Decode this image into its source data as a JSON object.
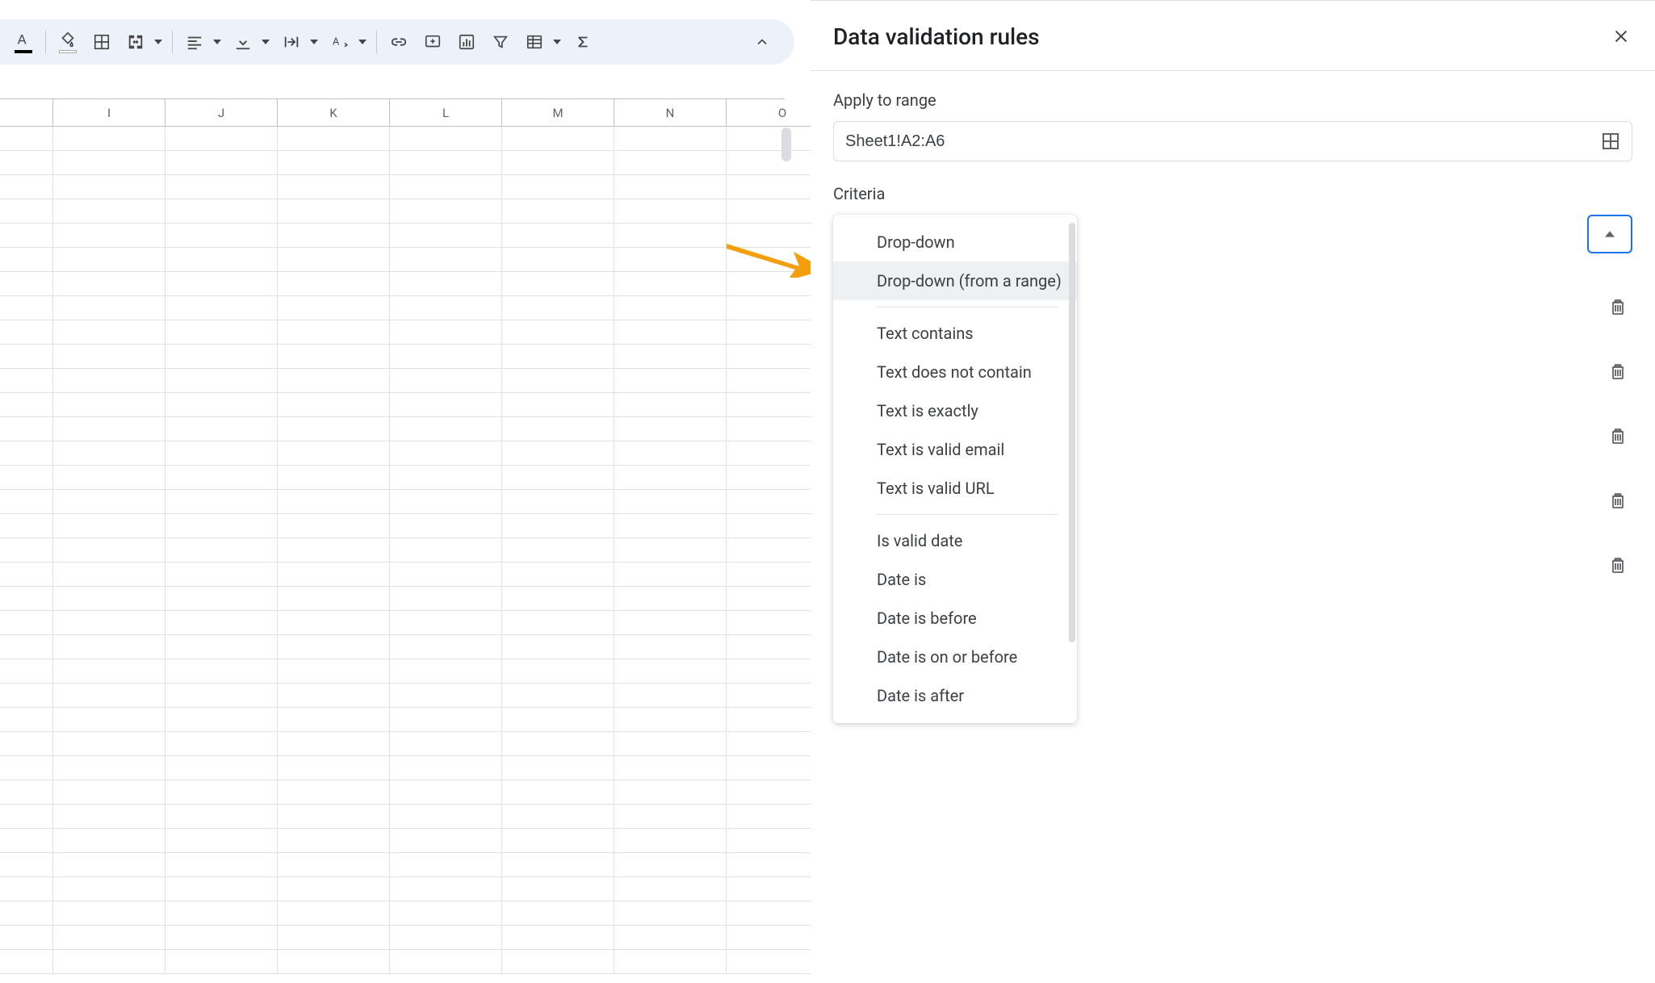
{
  "panel": {
    "title": "Data validation rules",
    "apply_label": "Apply to range",
    "range_value": "Sheet1!A2:A6",
    "criteria_label": "Criteria"
  },
  "criteria_options": [
    "Drop-down",
    "Drop-down (from a range)",
    "Text contains",
    "Text does not contain",
    "Text is exactly",
    "Text is valid email",
    "Text is valid URL",
    "Is valid date",
    "Date is",
    "Date is before",
    "Date is on or before",
    "Date is after"
  ],
  "columns": [
    "",
    "I",
    "J",
    "K",
    "L",
    "M",
    "N",
    "O"
  ],
  "accent_color": "#1a73e8",
  "arrow_color": "#f59e0b"
}
